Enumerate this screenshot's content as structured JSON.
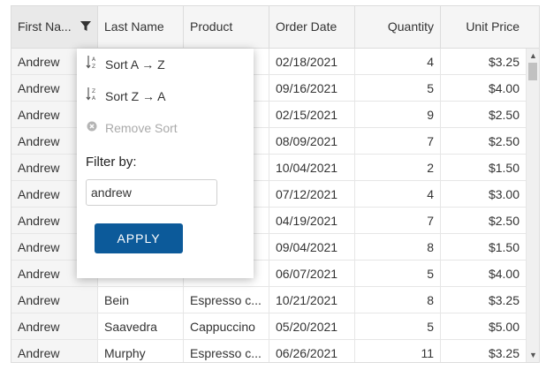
{
  "columns": [
    {
      "label": "First Na..."
    },
    {
      "label": "Last Name"
    },
    {
      "label": "Product"
    },
    {
      "label": "Order Date"
    },
    {
      "label": "Quantity"
    },
    {
      "label": "Unit Price"
    }
  ],
  "rows": [
    {
      "first": "Andrew",
      "last": "",
      "product": "",
      "date": "02/18/2021",
      "qty": "4",
      "price": "$3.25"
    },
    {
      "first": "Andrew",
      "last": "",
      "product": "",
      "date": "09/16/2021",
      "qty": "5",
      "price": "$4.00"
    },
    {
      "first": "Andrew",
      "last": "",
      "product": "",
      "date": "02/15/2021",
      "qty": "9",
      "price": "$2.50"
    },
    {
      "first": "Andrew",
      "last": "",
      "product": "",
      "date": "08/09/2021",
      "qty": "7",
      "price": "$2.50"
    },
    {
      "first": "Andrew",
      "last": "",
      "product": "",
      "date": "10/04/2021",
      "qty": "2",
      "price": "$1.50"
    },
    {
      "first": "Andrew",
      "last": "",
      "product": "",
      "date": "07/12/2021",
      "qty": "4",
      "price": "$3.00"
    },
    {
      "first": "Andrew",
      "last": "",
      "product": "",
      "date": "04/19/2021",
      "qty": "7",
      "price": "$2.50"
    },
    {
      "first": "Andrew",
      "last": "",
      "product": "",
      "date": "09/04/2021",
      "qty": "8",
      "price": "$1.50"
    },
    {
      "first": "Andrew",
      "last": "",
      "product": "",
      "date": "06/07/2021",
      "qty": "5",
      "price": "$4.00"
    },
    {
      "first": "Andrew",
      "last": "Bein",
      "product": "Espresso c...",
      "date": "10/21/2021",
      "qty": "8",
      "price": "$3.25"
    },
    {
      "first": "Andrew",
      "last": "Saavedra",
      "product": "Cappuccino",
      "date": "05/20/2021",
      "qty": "5",
      "price": "$5.00"
    },
    {
      "first": "Andrew",
      "last": "Murphy",
      "product": "Espresso c...",
      "date": "06/26/2021",
      "qty": "11",
      "price": "$3.25"
    }
  ],
  "menu": {
    "sort_asc": "Sort A → Z",
    "sort_desc": "Sort Z → A",
    "remove_sort": "Remove Sort",
    "filter_label": "Filter by:",
    "filter_value": "andrew",
    "apply": "APPLY"
  },
  "icons": {
    "filter": "funnel-icon",
    "sort_asc": "sort-ascending-icon",
    "sort_desc": "sort-descending-icon",
    "remove": "close-circle-icon"
  },
  "colors": {
    "apply_button": "#0c5a9a",
    "header_bg": "#f5f5f5"
  }
}
